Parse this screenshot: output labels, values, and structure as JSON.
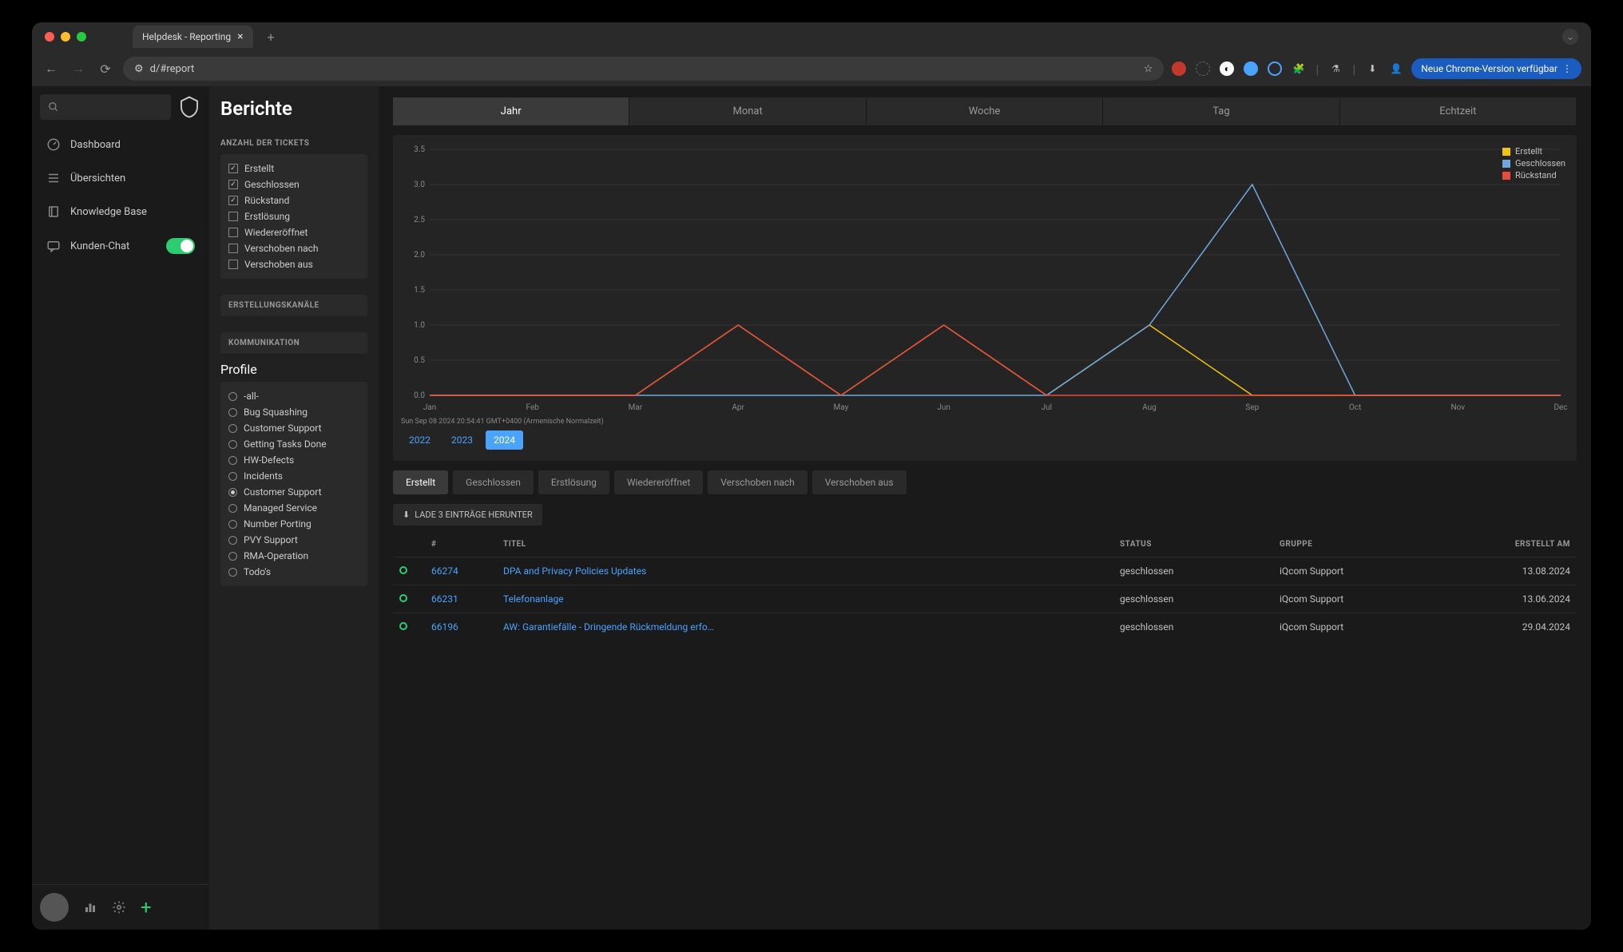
{
  "browser": {
    "tab_title": "Helpdesk - Reporting",
    "url": "d/#report",
    "update_label": "Neue Chrome-Version verfügbar"
  },
  "sidebar": {
    "items": [
      {
        "icon": "gauge",
        "label": "Dashboard"
      },
      {
        "icon": "list",
        "label": "Übersichten"
      },
      {
        "icon": "book",
        "label": "Knowledge Base"
      },
      {
        "icon": "chat",
        "label": "Kunden-Chat",
        "toggle": true
      }
    ]
  },
  "page_title": "Berichte",
  "filters": {
    "ticket_count_header": "ANZAHL DER TICKETS",
    "ticket_count": [
      {
        "label": "Erstellt",
        "checked": true
      },
      {
        "label": "Geschlossen",
        "checked": true
      },
      {
        "label": "Rückstand",
        "checked": true
      },
      {
        "label": "Erstlösung",
        "checked": false
      },
      {
        "label": "Wiedereröffnet",
        "checked": false
      },
      {
        "label": "Verschoben nach",
        "checked": false
      },
      {
        "label": "Verschoben aus",
        "checked": false
      }
    ],
    "channels_header": "ERSTELLUNGSKANÄLE",
    "communication_header": "KOMMUNIKATION",
    "profile_header": "Profile",
    "profiles": [
      {
        "label": "-all-",
        "selected": false
      },
      {
        "label": "Bug Squashing",
        "selected": false
      },
      {
        "label": "Customer Support",
        "selected": false
      },
      {
        "label": "Getting Tasks Done",
        "selected": false
      },
      {
        "label": "HW-Defects",
        "selected": false
      },
      {
        "label": "Incidents",
        "selected": false
      },
      {
        "label": "Customer Support",
        "selected": true
      },
      {
        "label": "Managed Service",
        "selected": false
      },
      {
        "label": "Number Porting",
        "selected": false
      },
      {
        "label": "PVY Support",
        "selected": false
      },
      {
        "label": "RMA-Operation",
        "selected": false
      },
      {
        "label": "Todo's",
        "selected": false
      }
    ]
  },
  "time_tabs": [
    "Jahr",
    "Monat",
    "Woche",
    "Tag",
    "Echtzeit"
  ],
  "time_tab_active": 0,
  "timestamp": "Sun Sep 08 2024 20:54:41 GMT+0400 (Armenische Normalzeit)",
  "years": [
    "2022",
    "2023",
    "2024"
  ],
  "year_active": 2,
  "status_tabs": [
    "Erstellt",
    "Geschlossen",
    "Erstlösung",
    "Wiedereröffnet",
    "Verschoben nach",
    "Verschoben aus"
  ],
  "status_tab_active": 0,
  "download_label": "LADE 3 EINTRÄGE HERUNTER",
  "chart_data": {
    "type": "line",
    "x": [
      "Jan",
      "Feb",
      "Mar",
      "Apr",
      "May",
      "Jun",
      "Jul",
      "Aug",
      "Sep",
      "Oct",
      "Nov",
      "Dec"
    ],
    "ylim": [
      0,
      3.5
    ],
    "ytick": [
      0.0,
      0.5,
      1.0,
      1.5,
      2.0,
      2.5,
      3.0,
      3.5
    ],
    "series": [
      {
        "name": "Erstellt",
        "color": "#f1c40f",
        "values": [
          0,
          0,
          0,
          1,
          0,
          1,
          0,
          1,
          0,
          0,
          0,
          0
        ]
      },
      {
        "name": "Geschlossen",
        "color": "#6fa8dc",
        "values": [
          0,
          0,
          0,
          0,
          0,
          0,
          0,
          1,
          3,
          0,
          0,
          0
        ]
      },
      {
        "name": "Rückstand",
        "color": "#e74c3c",
        "values": [
          0,
          0,
          0,
          1,
          0,
          1,
          0,
          0,
          0,
          0,
          0,
          0
        ]
      }
    ]
  },
  "table": {
    "headers": {
      "num": "#",
      "title": "TITEL",
      "status": "STATUS",
      "group": "GRUPPE",
      "created": "ERSTELLT AM"
    },
    "rows": [
      {
        "id": "66274",
        "title": "DPA and Privacy Policies Updates",
        "status": "geschlossen",
        "group": "iQcom Support",
        "created": "13.08.2024"
      },
      {
        "id": "66231",
        "title": "Telefonanlage",
        "status": "geschlossen",
        "group": "iQcom Support",
        "created": "13.06.2024"
      },
      {
        "id": "66196",
        "title": "AW: Garantiefälle - Dringende Rückmeldung erfo…",
        "status": "geschlossen",
        "group": "iQcom Support",
        "created": "29.04.2024"
      }
    ]
  }
}
